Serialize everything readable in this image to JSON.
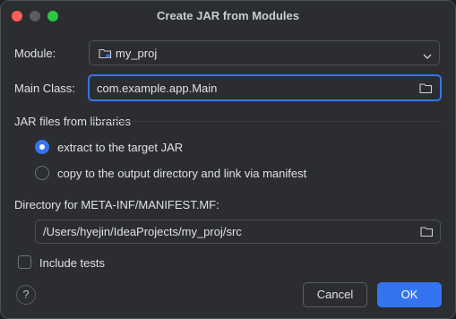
{
  "window": {
    "title": "Create JAR from Modules"
  },
  "module": {
    "label": "Module:",
    "value": "my_proj"
  },
  "main_class": {
    "label": "Main Class:",
    "value": "com.example.app.Main"
  },
  "libraries": {
    "section_title": "JAR files from libraries",
    "options": [
      {
        "label": "extract to the target JAR",
        "selected": true
      },
      {
        "label": "copy to the output directory and link via manifest",
        "selected": false
      }
    ]
  },
  "manifest": {
    "label": "Directory for META-INF/MANIFEST.MF:",
    "value": "/Users/hyejin/IdeaProjects/my_proj/src"
  },
  "include_tests": {
    "label": "Include tests",
    "checked": false
  },
  "buttons": {
    "help": "?",
    "cancel": "Cancel",
    "ok": "OK"
  },
  "colors": {
    "accent": "#3574f0",
    "background": "#2b2d30",
    "text": "#dfe1e5"
  }
}
